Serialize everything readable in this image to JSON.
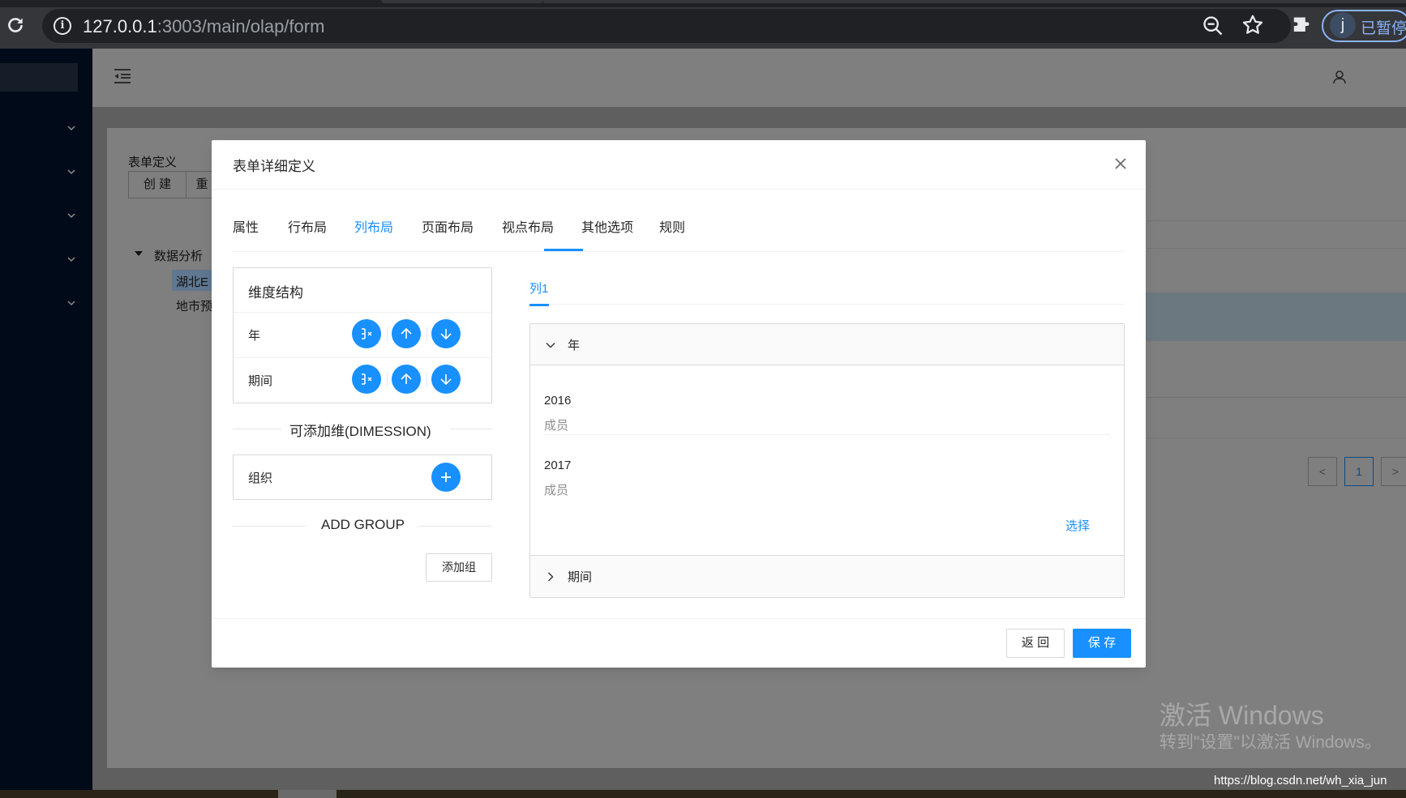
{
  "browser": {
    "url_host": "127.0.0.1",
    "url_path": ":3003/main/olap/form",
    "profile_initial": "j",
    "profile_label": "已暂停"
  },
  "background": {
    "section_title": "表单定义",
    "btn_create": "创 建",
    "btn_second": "重",
    "tree_root": "数据分析",
    "tree_child_1": "湖北E",
    "tree_child_2": "地市预",
    "page_current": "1",
    "page_prev_icon": "left-icon",
    "page_next_icon": "right-icon"
  },
  "modal": {
    "title": "表单详细定义",
    "tabs": [
      "属性",
      "行布局",
      "列布局",
      "页面布局",
      "视点布局",
      "其他选项",
      "规则"
    ],
    "active_tab_index": 2,
    "dimension_structure": {
      "title": "维度结构",
      "rows": [
        {
          "label": "年"
        },
        {
          "label": "期间"
        }
      ]
    },
    "available_title": "可添加维(DIMESSION)",
    "available_dims": [
      {
        "label": "组织"
      }
    ],
    "add_group_title": "ADD GROUP",
    "add_group_button": "添加组",
    "column_tabs": [
      "列1"
    ],
    "panels": [
      {
        "label": "年",
        "expanded": true,
        "members": [
          {
            "name": "2016",
            "type": "成员"
          },
          {
            "name": "2017",
            "type": "成员"
          }
        ],
        "select_link": "选择"
      },
      {
        "label": "期间",
        "expanded": false
      }
    ],
    "footer": {
      "back": "返 回",
      "save": "保 存"
    }
  },
  "watermark": {
    "line1": "激活 Windows",
    "line2": "转到\"设置\"以激活 Windows。",
    "blog_url": "https://blog.csdn.net/wh_xia_jun"
  },
  "colors": {
    "primary": "#1890ff",
    "chrome_bar": "#35363a",
    "sidebar": "#000a18"
  }
}
